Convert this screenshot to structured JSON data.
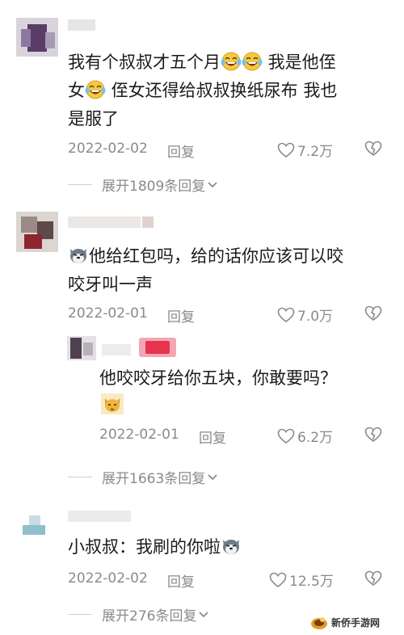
{
  "comments": [
    {
      "text_a": "我有个叔叔才五个月",
      "text_b": " 我是他侄",
      "text_c": "女",
      "text_d": " 侄女还得给叔叔换纸尿布 我也",
      "text_e": "是服了",
      "date": "2022-02-02",
      "reply_label": "回复",
      "likes": "7.2万",
      "expand_label": "展开1809条回复"
    },
    {
      "text_a": "他给红包吗，给的话你应该可以咬",
      "text_b": "咬牙叫一声",
      "date": "2022-02-01",
      "reply_label": "回复",
      "likes": "7.0万"
    },
    {
      "text_a": "他咬咬牙给你五块，你敢要吗？",
      "date": "2022-02-01",
      "reply_label": "回复",
      "likes": "6.2万",
      "expand_label": "展开1663条回复"
    },
    {
      "text_a": "小叔叔：我刷的你啦",
      "date": "2022-02-02",
      "reply_label": "回复",
      "likes": "12.5万",
      "expand_label": "展开276条回复"
    }
  ],
  "watermark": "新侨手游网",
  "icons": {
    "like": "heart-outline-icon",
    "dislike": "broken-heart-icon",
    "expand": "chevron-down-icon",
    "emoji_laugh": "laughing-tears-emoji",
    "emoji_dog": "husky-dog-emoji",
    "emoji_cat": "cat-emoji"
  }
}
